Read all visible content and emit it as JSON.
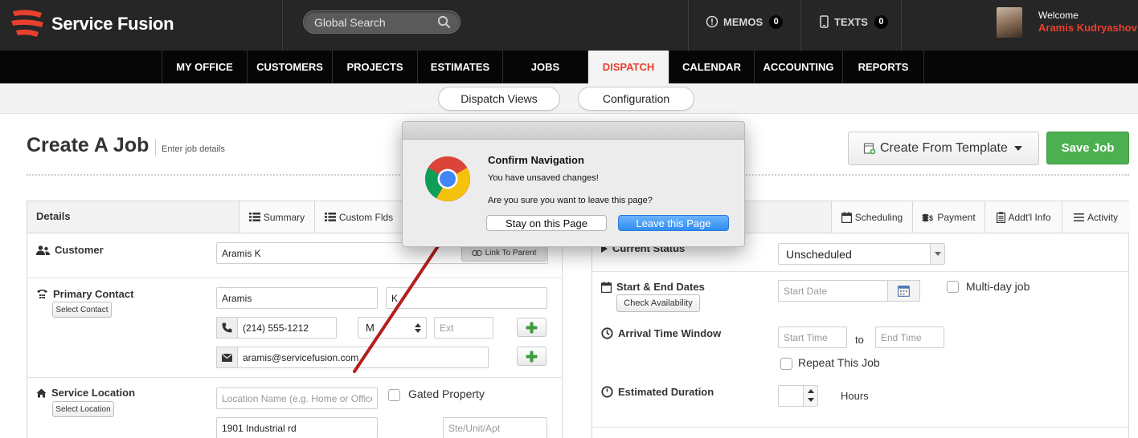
{
  "header": {
    "logo_text": "Service Fusion",
    "search_placeholder": "Global Search",
    "memos_label": "MEMOS",
    "memos_count": "0",
    "texts_label": "TEXTS",
    "texts_count": "0",
    "welcome": "Welcome",
    "user_name": "Aramis Kudryashov"
  },
  "nav": {
    "tabs": [
      "MY OFFICE",
      "CUSTOMERS",
      "PROJECTS",
      "ESTIMATES",
      "JOBS",
      "DISPATCH",
      "CALENDAR",
      "ACCOUNTING",
      "REPORTS"
    ],
    "active": "DISPATCH"
  },
  "subnav": {
    "dispatch_views": "Dispatch Views",
    "configuration": "Configuration"
  },
  "page": {
    "title": "Create A Job",
    "subtitle": "Enter job details",
    "create_template": "Create From Template",
    "save_job": "Save Job"
  },
  "details_panel": {
    "title": "Details",
    "tab_summary": "Summary",
    "tab_custom": "Custom Flds",
    "customer_label": "Customer",
    "customer_value": "Aramis K",
    "link_parent": "Link To Parent",
    "primary_contact_label": "Primary Contact",
    "select_contact": "Select Contact",
    "first_name": "Aramis",
    "last_name": "K",
    "phone": "(214) 555-1212",
    "phone_type": "M",
    "ext_placeholder": "Ext",
    "email": "aramis@servicefusion.com",
    "service_location_label": "Service Location",
    "select_location": "Select Location",
    "location_name_placeholder": "Location Name (e.g. Home or Office)",
    "gated_property": "Gated Property",
    "address": "1901 Industrial rd",
    "unit_placeholder": "Ste/Unit/Apt"
  },
  "schedule_panel": {
    "tab_scheduling": "Scheduling",
    "tab_payment": "Payment",
    "tab_addl": "Addt'l Info",
    "tab_activity": "Activity",
    "current_status_label": "Current Status",
    "status_value": "Unscheduled",
    "dates_label": "Start & End Dates",
    "check_availability": "Check Availability",
    "start_date_placeholder": "Start Date",
    "multi_day": "Multi-day job",
    "arrival_label": "Arrival Time Window",
    "start_time_placeholder": "Start Time",
    "to_label": "to",
    "end_time_placeholder": "End Time",
    "repeat_job": "Repeat This Job",
    "duration_label": "Estimated Duration",
    "hours_label": "Hours"
  },
  "dialog": {
    "title": "Confirm Navigation",
    "line1": "You have unsaved changes!",
    "line2": "Are you sure you want to leave this page?",
    "stay": "Stay on this Page",
    "leave": "Leave this Page"
  },
  "colors": {
    "brand_red": "#e8402e",
    "save_green": "#4caf50",
    "dialog_blue": "#2f8ef3",
    "annotation_arrow": "#b3211b"
  }
}
